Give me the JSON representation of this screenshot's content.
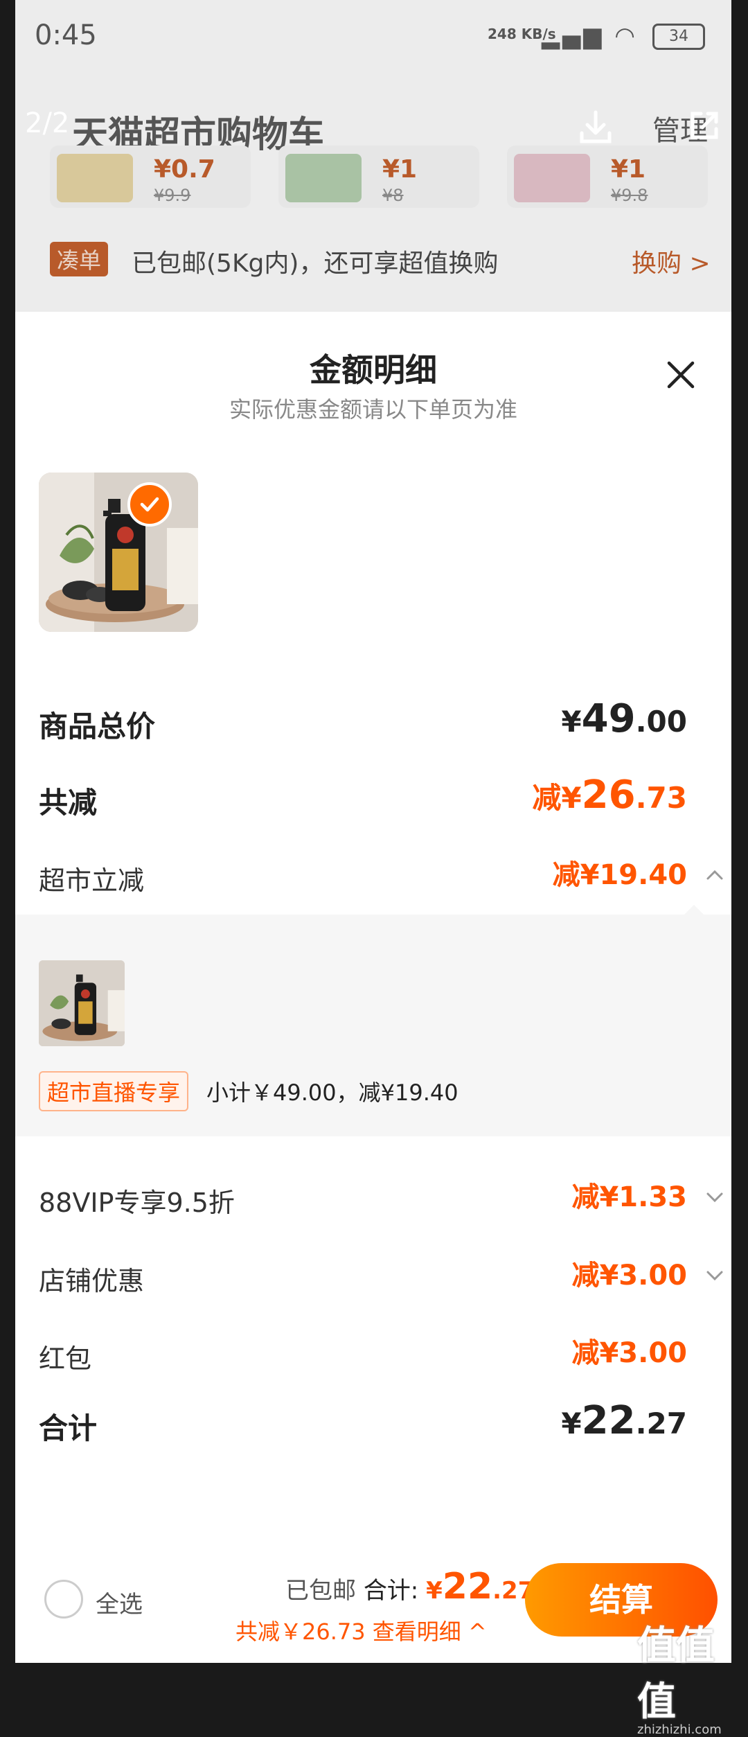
{
  "status_bar": {
    "time": "0:45",
    "speed": "248 KB/s",
    "battery": "34"
  },
  "cart_header": {
    "page_indicator": "2/2",
    "title": "天猫超市购物车",
    "manage": "管理",
    "icons": [
      "download-icon",
      "share-icon"
    ]
  },
  "cart_thumbs": [
    {
      "price": "¥0.7",
      "orig": "¥9.9"
    },
    {
      "price": "¥1",
      "orig": "¥8"
    },
    {
      "price": "¥1",
      "orig": "¥9.8"
    }
  ],
  "bundle_bar": {
    "tag": "凑单",
    "text": "已包邮(5Kg内)，还可享超值换购",
    "action": "换购 >"
  },
  "sheet": {
    "title": "金额明细",
    "subtitle": "实际优惠金额请以下单页为准",
    "total_price": {
      "label": "商品总价",
      "yen": "¥",
      "int": "49",
      "dec": ".00"
    },
    "total_reduce": {
      "label": "共减",
      "prefix": "减¥",
      "int": "26",
      "dec": ".73"
    },
    "market_reduce": {
      "label": "超市立减",
      "value": "减¥19.40",
      "expanded": true
    },
    "sub_panel": {
      "badge": "超市直播专享",
      "subtotal": "小计￥49.00，减¥19.40"
    },
    "vip": {
      "label": "88VIP专享9.5折",
      "value": "减¥1.33"
    },
    "shop": {
      "label": "店铺优惠",
      "value": "减¥3.00"
    },
    "redpacket": {
      "label": "红包",
      "value": "减¥3.00"
    },
    "sum": {
      "label": "合计",
      "yen": "¥",
      "int": "22",
      "dec": ".27"
    }
  },
  "footer": {
    "select_all": "全选",
    "shipping": "已包邮",
    "total_label": "合计:",
    "total_yen": "¥",
    "total_int": "22",
    "total_dec": ".27",
    "save_text": "共减￥26.73",
    "detail_link": "查看明细 ^",
    "checkout": "结算"
  },
  "watermark": {
    "logo": "值值值",
    "site": "zhizhizhi.com"
  },
  "colors": {
    "accent": "#ff5500",
    "checkout_start": "#ff9a00",
    "checkout_end": "#ff5000"
  }
}
